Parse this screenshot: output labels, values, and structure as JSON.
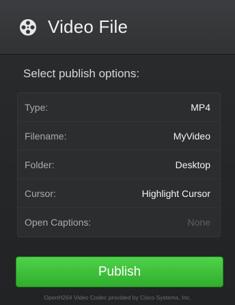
{
  "header": {
    "icon": "film-reel-icon",
    "title": "Video File"
  },
  "subtitle": "Select publish options:",
  "options": [
    {
      "label": "Type:",
      "value": "MP4",
      "enabled": true
    },
    {
      "label": "Filename:",
      "value": "MyVideo",
      "enabled": true
    },
    {
      "label": "Folder:",
      "value": "Desktop",
      "enabled": true
    },
    {
      "label": "Cursor:",
      "value": "Highlight Cursor",
      "enabled": true
    },
    {
      "label": "Open Captions:",
      "value": "None",
      "enabled": false
    }
  ],
  "publish_label": "Publish",
  "footer": "OpenH264 Video Codec provided by Cisco Systems, Inc.",
  "colors": {
    "accent": "#3bbf37",
    "background": "#232527"
  }
}
